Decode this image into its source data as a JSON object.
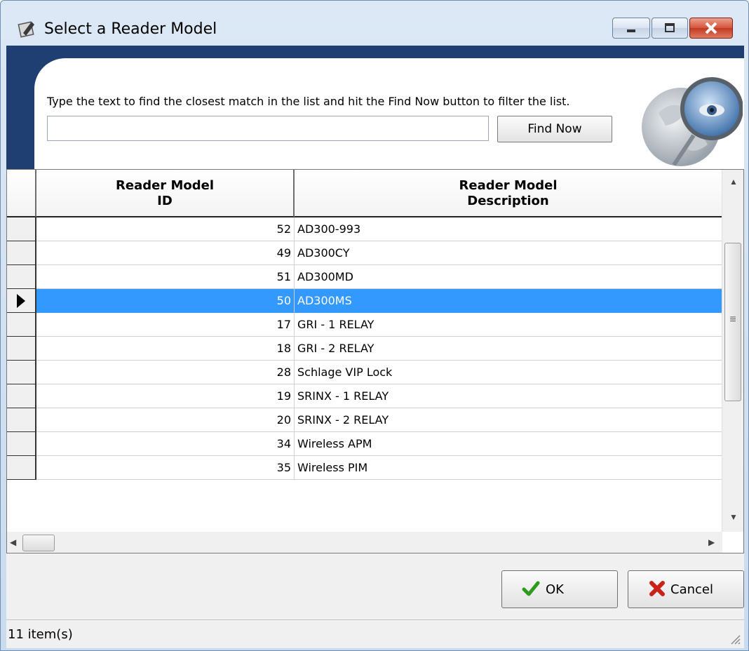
{
  "window": {
    "title": "Select a Reader Model"
  },
  "search": {
    "hint": "Type the text to find the closest match in the list and hit the Find Now button to filter the list.",
    "value": "",
    "find_now_label": "Find Now"
  },
  "grid": {
    "columns": [
      "Reader Model\nID",
      "Reader Model\nDescription"
    ],
    "rows": [
      {
        "id": "52",
        "description": "AD300-993"
      },
      {
        "id": "49",
        "description": "AD300CY"
      },
      {
        "id": "51",
        "description": "AD300MD"
      },
      {
        "id": "50",
        "description": "AD300MS",
        "selected": true
      },
      {
        "id": "17",
        "description": "GRI - 1 RELAY"
      },
      {
        "id": "18",
        "description": "GRI - 2 RELAY"
      },
      {
        "id": "28",
        "description": "Schlage VIP Lock"
      },
      {
        "id": "19",
        "description": "SRINX - 1 RELAY"
      },
      {
        "id": "20",
        "description": "SRINX - 2 RELAY"
      },
      {
        "id": "34",
        "description": "Wireless APM"
      },
      {
        "id": "35",
        "description": "Wireless PIM"
      }
    ]
  },
  "buttons": {
    "ok_label": "OK",
    "cancel_label": "Cancel"
  },
  "status": {
    "text": "11 item(s)"
  },
  "colors": {
    "selection": "#3399ff",
    "search_panel": "#1f3f73",
    "ok_icon": "#2e9a1e",
    "cancel_icon": "#c8221b"
  },
  "icons": [
    "app-icon",
    "minimize-icon",
    "maximize-icon",
    "close-icon",
    "globe-magnifier-icon",
    "row-pointer-icon",
    "checkmark-icon",
    "x-icon",
    "resize-grip-icon"
  ]
}
